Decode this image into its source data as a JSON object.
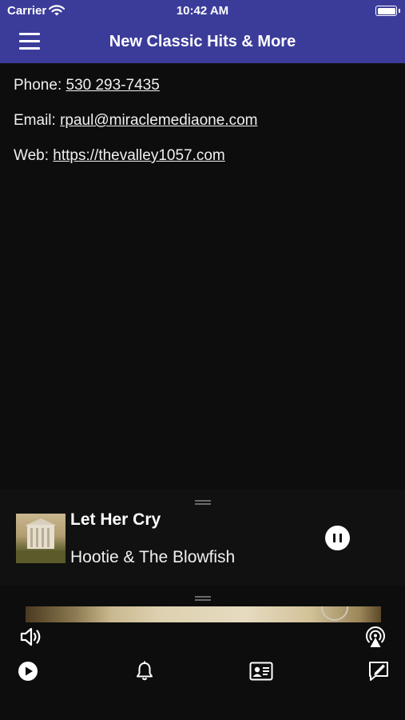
{
  "status_bar": {
    "carrier": "Carrier",
    "time": "10:42 AM",
    "icons": [
      "wifi-icon",
      "battery-icon"
    ]
  },
  "nav": {
    "title": "New Classic Hits & More",
    "menu_icon": "hamburger-menu-icon",
    "background": "#3b3c9a"
  },
  "contact": {
    "phone_label": "Phone:",
    "phone": "530 293-7435",
    "email_label": "Email:",
    "email": "rpaul@miraclemediaone.com",
    "web_label": "Web:",
    "web": "https://thevalley1057.com"
  },
  "now_playing": {
    "title": "Let Her Cry",
    "artist": "Hootie & The Blowfish",
    "state": "playing",
    "control_icon": "pause-icon"
  },
  "player_controls": {
    "volume_icon": "speaker-volume-icon",
    "airplay_icon": "airplay-icon"
  },
  "tab_bar": {
    "items": [
      {
        "icon": "play-circle-icon"
      },
      {
        "icon": "bell-icon"
      },
      {
        "icon": "contact-card-icon"
      },
      {
        "icon": "compose-message-icon"
      }
    ]
  },
  "colors": {
    "background": "#0d0d0d",
    "accent": "#3b3c9a",
    "text": "#f0f0f0"
  }
}
